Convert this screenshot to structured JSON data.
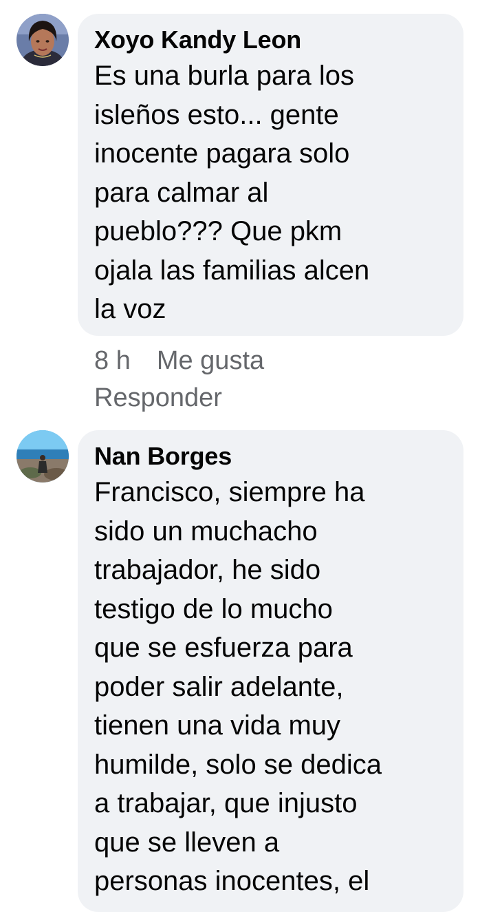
{
  "comments": [
    {
      "author": "Xoyo Kandy Leon",
      "text": "Es una burla para los\nisleños esto... gente\ninocente pagara solo\npara calmar al\npueblo??? Que pkm\nojala las familias alcen\nla voz",
      "time": "8 h",
      "like_label": "Me gusta",
      "reply_label": "Responder"
    },
    {
      "author": "Nan Borges",
      "text": "Francisco, siempre ha\nsido un muchacho\ntrabajador, he sido\ntestigo de lo mucho\nque se esfuerza para\npoder salir adelante,\ntienen una vida muy\nhumilde, solo se dedica\na trabajar, que injusto\nque se lleven a\npersonas inocentes, el"
    }
  ],
  "colors": {
    "bubble_bg": "#f0f2f5",
    "text": "#050505",
    "meta_text": "#65676b"
  }
}
